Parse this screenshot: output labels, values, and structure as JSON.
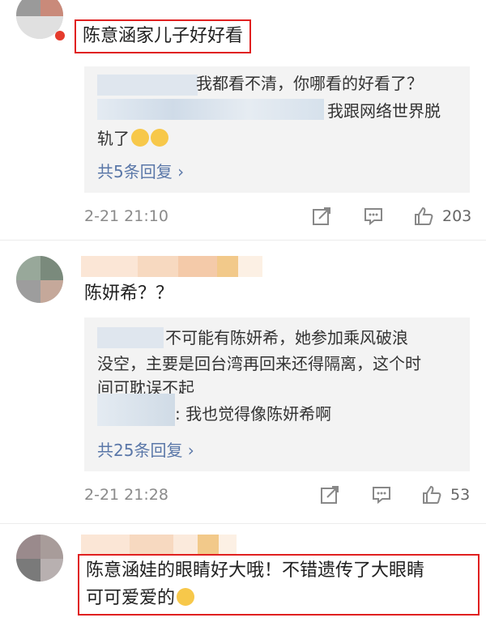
{
  "comments": [
    {
      "text": "陈意涵家儿子好好看",
      "replies": [
        {
          "text": "我都看不清，你哪看的好看了？"
        },
        {
          "text": "我跟网络世界脱"
        },
        {
          "text": "轨了"
        }
      ],
      "more_replies": "共5条回复 ›",
      "time": "2-21 21:10",
      "likes": "203"
    },
    {
      "text": "陈妍希？？",
      "replies": [
        {
          "text": "不可能有陈妍希，她参加乘风破浪"
        },
        {
          "text": "没空，主要是回台湾再回来还得隔离，这个时"
        },
        {
          "text": "间可耽误不起"
        },
        {
          "text": ": 我也觉得像陈妍希啊"
        }
      ],
      "more_replies": "共25条回复 ›",
      "time": "2-21 21:28",
      "likes": "53"
    },
    {
      "text_line1": "陈意涵娃的眼睛好大哦！不错遗传了大眼睛",
      "text_line2": "可可爱爱的"
    }
  ],
  "icons": {
    "share": "share-icon",
    "comment": "comment-icon",
    "like": "like-icon",
    "emoji": "laughing-emoji-icon"
  },
  "colors": {
    "highlight_border": "#e02020",
    "link": "#5a77a8",
    "meta": "#8a8a8a",
    "reply_bg": "#f3f3f3"
  }
}
